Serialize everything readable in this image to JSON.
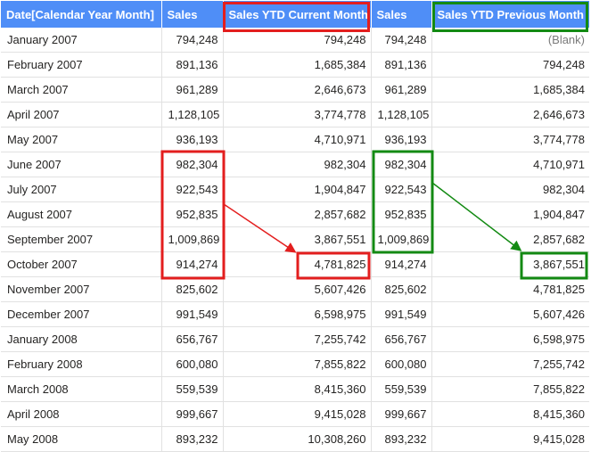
{
  "columns": [
    "Date[Calendar Year Month]",
    "Sales",
    "Sales YTD Current Month",
    "Sales",
    "Sales YTD Previous Month"
  ],
  "rows": [
    [
      "January 2007",
      "794,248",
      "794,248",
      "794,248",
      "(Blank)"
    ],
    [
      "February 2007",
      "891,136",
      "1,685,384",
      "891,136",
      "794,248"
    ],
    [
      "March 2007",
      "961,289",
      "2,646,673",
      "961,289",
      "1,685,384"
    ],
    [
      "April 2007",
      "1,128,105",
      "3,774,778",
      "1,128,105",
      "2,646,673"
    ],
    [
      "May 2007",
      "936,193",
      "4,710,971",
      "936,193",
      "3,774,778"
    ],
    [
      "June 2007",
      "982,304",
      "982,304",
      "982,304",
      "4,710,971"
    ],
    [
      "July 2007",
      "922,543",
      "1,904,847",
      "922,543",
      "982,304"
    ],
    [
      "August 2007",
      "952,835",
      "2,857,682",
      "952,835",
      "1,904,847"
    ],
    [
      "September 2007",
      "1,009,869",
      "3,867,551",
      "1,009,869",
      "2,857,682"
    ],
    [
      "October 2007",
      "914,274",
      "4,781,825",
      "914,274",
      "3,867,551"
    ],
    [
      "November 2007",
      "825,602",
      "5,607,426",
      "825,602",
      "4,781,825"
    ],
    [
      "December 2007",
      "991,549",
      "6,598,975",
      "991,549",
      "5,607,426"
    ],
    [
      "January 2008",
      "656,767",
      "7,255,742",
      "656,767",
      "6,598,975"
    ],
    [
      "February 2008",
      "600,080",
      "7,855,822",
      "600,080",
      "7,255,742"
    ],
    [
      "March 2008",
      "559,539",
      "8,415,360",
      "559,539",
      "7,855,822"
    ],
    [
      "April 2008",
      "999,667",
      "9,415,028",
      "999,667",
      "8,415,360"
    ],
    [
      "May 2008",
      "893,232",
      "10,308,260",
      "893,232",
      "9,415,028"
    ]
  ],
  "colors": {
    "header_bg": "#4f8ef7",
    "highlight_red": "#e31e1e",
    "highlight_green": "#138a13"
  }
}
